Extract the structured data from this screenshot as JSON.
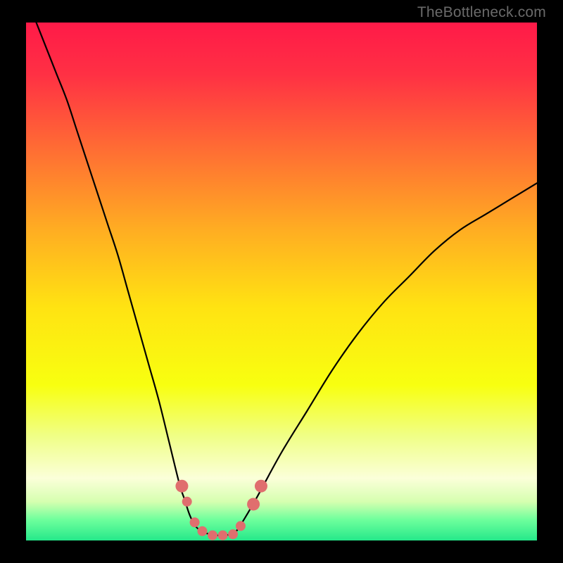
{
  "watermark": "TheBottleneck.com",
  "chart_data": {
    "type": "line",
    "title": "",
    "xlabel": "",
    "ylabel": "",
    "xlim": [
      0,
      100
    ],
    "ylim": [
      0,
      100
    ],
    "grid": false,
    "legend": false,
    "gradient_stops": [
      {
        "offset": 0.0,
        "color": "#ff1a48"
      },
      {
        "offset": 0.1,
        "color": "#ff3044"
      },
      {
        "offset": 0.25,
        "color": "#ff6f33"
      },
      {
        "offset": 0.4,
        "color": "#ffad22"
      },
      {
        "offset": 0.55,
        "color": "#ffe312"
      },
      {
        "offset": 0.7,
        "color": "#f8ff10"
      },
      {
        "offset": 0.8,
        "color": "#f0ff88"
      },
      {
        "offset": 0.88,
        "color": "#fbffd9"
      },
      {
        "offset": 0.925,
        "color": "#d6ffb0"
      },
      {
        "offset": 0.96,
        "color": "#6eff9c"
      },
      {
        "offset": 1.0,
        "color": "#25e88a"
      }
    ],
    "series": [
      {
        "name": "bottleneck-curve",
        "stroke": "#000000",
        "stroke_width": 2.2,
        "x": [
          2,
          4,
          6,
          8,
          10,
          12,
          14,
          16,
          18,
          20,
          22,
          24,
          26,
          28,
          30,
          31,
          32,
          33,
          34,
          35,
          36,
          37,
          38,
          39,
          40,
          41,
          42,
          45,
          50,
          55,
          60,
          65,
          70,
          75,
          80,
          85,
          90,
          95,
          100
        ],
        "y": [
          100,
          95,
          90,
          85,
          79,
          73,
          67,
          61,
          55,
          48,
          41,
          34,
          27,
          19,
          11,
          8,
          5,
          3,
          2,
          1.5,
          1.2,
          1,
          1,
          1,
          1.2,
          1.7,
          3,
          8,
          17,
          25,
          33,
          40,
          46,
          51,
          56,
          60,
          63,
          66,
          69
        ]
      }
    ],
    "markers": {
      "name": "highlighted-points",
      "color": "#e06e6e",
      "radius_major": 9,
      "radius_minor": 7,
      "points": [
        {
          "x": 30.5,
          "y": 10.5
        },
        {
          "x": 31.5,
          "y": 7.5
        },
        {
          "x": 33.0,
          "y": 3.5
        },
        {
          "x": 34.5,
          "y": 1.8
        },
        {
          "x": 36.5,
          "y": 1.0
        },
        {
          "x": 38.5,
          "y": 1.0
        },
        {
          "x": 40.5,
          "y": 1.2
        },
        {
          "x": 42.0,
          "y": 2.8
        },
        {
          "x": 44.5,
          "y": 7.0
        },
        {
          "x": 46.0,
          "y": 10.5
        }
      ]
    }
  }
}
